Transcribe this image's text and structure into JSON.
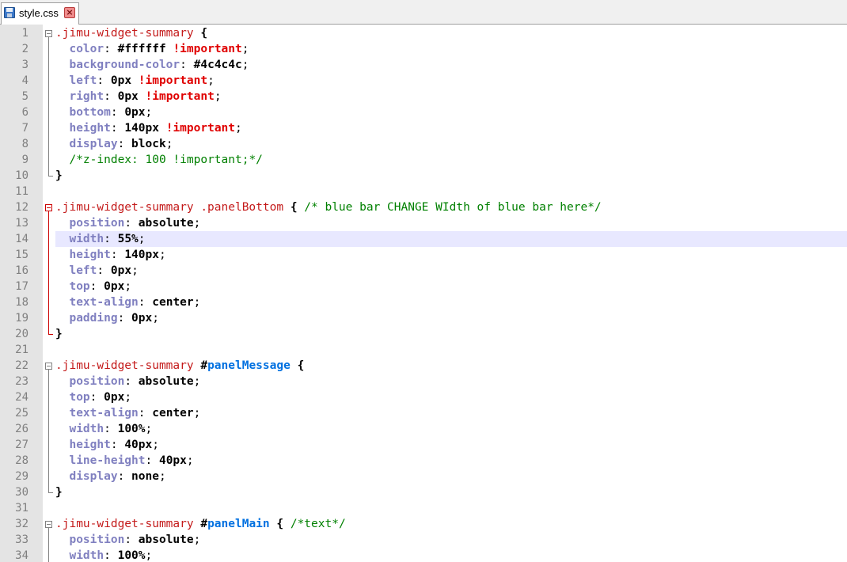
{
  "tab": {
    "filename": "style.css",
    "icon": "save-disk-icon",
    "close_icon": "close-icon"
  },
  "colors": {
    "selector": "#c41a1a",
    "property": "#8080c0",
    "important": "#e00000",
    "comment": "#008000",
    "id": "#0070e0",
    "highlight_line": "#e8e8ff",
    "gutter": "#e4e4e4"
  },
  "highlighted_line": 14,
  "lines": [
    {
      "n": "1",
      "t": [
        {
          "c": "sel",
          "s": ".jimu-widget-summary "
        },
        {
          "c": "brace",
          "s": "{"
        }
      ]
    },
    {
      "n": "2",
      "t": [
        {
          "c": "pun",
          "s": "  "
        },
        {
          "c": "prop",
          "s": "color"
        },
        {
          "c": "pun",
          "s": ": "
        },
        {
          "c": "val",
          "s": "#ffffff "
        },
        {
          "c": "imp",
          "s": "!important"
        },
        {
          "c": "pun",
          "s": ";"
        }
      ]
    },
    {
      "n": "3",
      "t": [
        {
          "c": "pun",
          "s": "  "
        },
        {
          "c": "prop",
          "s": "background-color"
        },
        {
          "c": "pun",
          "s": ": "
        },
        {
          "c": "val",
          "s": "#4c4c4c"
        },
        {
          "c": "pun",
          "s": ";"
        }
      ]
    },
    {
      "n": "4",
      "t": [
        {
          "c": "pun",
          "s": "  "
        },
        {
          "c": "prop",
          "s": "left"
        },
        {
          "c": "pun",
          "s": ": "
        },
        {
          "c": "val",
          "s": "0px "
        },
        {
          "c": "imp",
          "s": "!important"
        },
        {
          "c": "pun",
          "s": ";"
        }
      ]
    },
    {
      "n": "5",
      "t": [
        {
          "c": "pun",
          "s": "  "
        },
        {
          "c": "prop",
          "s": "right"
        },
        {
          "c": "pun",
          "s": ": "
        },
        {
          "c": "val",
          "s": "0px "
        },
        {
          "c": "imp",
          "s": "!important"
        },
        {
          "c": "pun",
          "s": ";"
        }
      ]
    },
    {
      "n": "6",
      "t": [
        {
          "c": "pun",
          "s": "  "
        },
        {
          "c": "prop",
          "s": "bottom"
        },
        {
          "c": "pun",
          "s": ": "
        },
        {
          "c": "val",
          "s": "0px"
        },
        {
          "c": "pun",
          "s": ";"
        }
      ]
    },
    {
      "n": "7",
      "t": [
        {
          "c": "pun",
          "s": "  "
        },
        {
          "c": "prop",
          "s": "height"
        },
        {
          "c": "pun",
          "s": ": "
        },
        {
          "c": "val",
          "s": "140px "
        },
        {
          "c": "imp",
          "s": "!important"
        },
        {
          "c": "pun",
          "s": ";"
        }
      ]
    },
    {
      "n": "8",
      "t": [
        {
          "c": "pun",
          "s": "  "
        },
        {
          "c": "prop",
          "s": "display"
        },
        {
          "c": "pun",
          "s": ": "
        },
        {
          "c": "val",
          "s": "block"
        },
        {
          "c": "pun",
          "s": ";"
        }
      ]
    },
    {
      "n": "9",
      "t": [
        {
          "c": "pun",
          "s": "  "
        },
        {
          "c": "cmt",
          "s": "/*z-index: 100 !important;*/"
        }
      ]
    },
    {
      "n": "10",
      "t": [
        {
          "c": "brace",
          "s": "}"
        }
      ]
    },
    {
      "n": "11",
      "t": []
    },
    {
      "n": "12",
      "t": [
        {
          "c": "sel",
          "s": ".jimu-widget-summary .panelBottom "
        },
        {
          "c": "brace",
          "s": "{"
        },
        {
          "c": "pun",
          "s": " "
        },
        {
          "c": "cmt",
          "s": "/* blue bar CHANGE WIdth of blue bar here*/"
        }
      ]
    },
    {
      "n": "13",
      "t": [
        {
          "c": "pun",
          "s": "  "
        },
        {
          "c": "prop",
          "s": "position"
        },
        {
          "c": "pun",
          "s": ": "
        },
        {
          "c": "val",
          "s": "absolute"
        },
        {
          "c": "pun",
          "s": ";"
        }
      ]
    },
    {
      "n": "14",
      "t": [
        {
          "c": "pun",
          "s": "  "
        },
        {
          "c": "prop",
          "s": "width"
        },
        {
          "c": "pun",
          "s": ": "
        },
        {
          "c": "val",
          "s": "55%"
        },
        {
          "c": "pun",
          "s": ";"
        }
      ]
    },
    {
      "n": "15",
      "t": [
        {
          "c": "pun",
          "s": "  "
        },
        {
          "c": "prop",
          "s": "height"
        },
        {
          "c": "pun",
          "s": ": "
        },
        {
          "c": "val",
          "s": "140px"
        },
        {
          "c": "pun",
          "s": ";"
        }
      ]
    },
    {
      "n": "16",
      "t": [
        {
          "c": "pun",
          "s": "  "
        },
        {
          "c": "prop",
          "s": "left"
        },
        {
          "c": "pun",
          "s": ": "
        },
        {
          "c": "val",
          "s": "0px"
        },
        {
          "c": "pun",
          "s": ";"
        }
      ]
    },
    {
      "n": "17",
      "t": [
        {
          "c": "pun",
          "s": "  "
        },
        {
          "c": "prop",
          "s": "top"
        },
        {
          "c": "pun",
          "s": ": "
        },
        {
          "c": "val",
          "s": "0px"
        },
        {
          "c": "pun",
          "s": ";"
        }
      ]
    },
    {
      "n": "18",
      "t": [
        {
          "c": "pun",
          "s": "  "
        },
        {
          "c": "prop",
          "s": "text-align"
        },
        {
          "c": "pun",
          "s": ": "
        },
        {
          "c": "val",
          "s": "center"
        },
        {
          "c": "pun",
          "s": ";"
        }
      ]
    },
    {
      "n": "19",
      "t": [
        {
          "c": "pun",
          "s": "  "
        },
        {
          "c": "prop",
          "s": "padding"
        },
        {
          "c": "pun",
          "s": ": "
        },
        {
          "c": "val",
          "s": "0px"
        },
        {
          "c": "pun",
          "s": ";"
        }
      ]
    },
    {
      "n": "20",
      "t": [
        {
          "c": "brace",
          "s": "}"
        }
      ]
    },
    {
      "n": "21",
      "t": []
    },
    {
      "n": "22",
      "t": [
        {
          "c": "sel",
          "s": ".jimu-widget-summary "
        },
        {
          "c": "val",
          "s": "#"
        },
        {
          "c": "id",
          "s": "panelMessage"
        },
        {
          "c": "pun",
          "s": " "
        },
        {
          "c": "brace",
          "s": "{"
        }
      ]
    },
    {
      "n": "23",
      "t": [
        {
          "c": "pun",
          "s": "  "
        },
        {
          "c": "prop",
          "s": "position"
        },
        {
          "c": "pun",
          "s": ": "
        },
        {
          "c": "val",
          "s": "absolute"
        },
        {
          "c": "pun",
          "s": ";"
        }
      ]
    },
    {
      "n": "24",
      "t": [
        {
          "c": "pun",
          "s": "  "
        },
        {
          "c": "prop",
          "s": "top"
        },
        {
          "c": "pun",
          "s": ": "
        },
        {
          "c": "val",
          "s": "0px"
        },
        {
          "c": "pun",
          "s": ";"
        }
      ]
    },
    {
      "n": "25",
      "t": [
        {
          "c": "pun",
          "s": "  "
        },
        {
          "c": "prop",
          "s": "text-align"
        },
        {
          "c": "pun",
          "s": ": "
        },
        {
          "c": "val",
          "s": "center"
        },
        {
          "c": "pun",
          "s": ";"
        }
      ]
    },
    {
      "n": "26",
      "t": [
        {
          "c": "pun",
          "s": "  "
        },
        {
          "c": "prop",
          "s": "width"
        },
        {
          "c": "pun",
          "s": ": "
        },
        {
          "c": "val",
          "s": "100%"
        },
        {
          "c": "pun",
          "s": ";"
        }
      ]
    },
    {
      "n": "27",
      "t": [
        {
          "c": "pun",
          "s": "  "
        },
        {
          "c": "prop",
          "s": "height"
        },
        {
          "c": "pun",
          "s": ": "
        },
        {
          "c": "val",
          "s": "40px"
        },
        {
          "c": "pun",
          "s": ";"
        }
      ]
    },
    {
      "n": "28",
      "t": [
        {
          "c": "pun",
          "s": "  "
        },
        {
          "c": "prop",
          "s": "line-height"
        },
        {
          "c": "pun",
          "s": ": "
        },
        {
          "c": "val",
          "s": "40px"
        },
        {
          "c": "pun",
          "s": ";"
        }
      ]
    },
    {
      "n": "29",
      "t": [
        {
          "c": "pun",
          "s": "  "
        },
        {
          "c": "prop",
          "s": "display"
        },
        {
          "c": "pun",
          "s": ": "
        },
        {
          "c": "val",
          "s": "none"
        },
        {
          "c": "pun",
          "s": ";"
        }
      ]
    },
    {
      "n": "30",
      "t": [
        {
          "c": "brace",
          "s": "}"
        }
      ]
    },
    {
      "n": "31",
      "t": []
    },
    {
      "n": "32",
      "t": [
        {
          "c": "sel",
          "s": ".jimu-widget-summary "
        },
        {
          "c": "val",
          "s": "#"
        },
        {
          "c": "id",
          "s": "panelMain"
        },
        {
          "c": "pun",
          "s": " "
        },
        {
          "c": "brace",
          "s": "{"
        },
        {
          "c": "pun",
          "s": " "
        },
        {
          "c": "cmt",
          "s": "/*text*/"
        }
      ]
    },
    {
      "n": "33",
      "t": [
        {
          "c": "pun",
          "s": "  "
        },
        {
          "c": "prop",
          "s": "position"
        },
        {
          "c": "pun",
          "s": ": "
        },
        {
          "c": "val",
          "s": "absolute"
        },
        {
          "c": "pun",
          "s": ";"
        }
      ]
    },
    {
      "n": "34",
      "t": [
        {
          "c": "pun",
          "s": "  "
        },
        {
          "c": "prop",
          "s": "width"
        },
        {
          "c": "pun",
          "s": ": "
        },
        {
          "c": "val",
          "s": "100%"
        },
        {
          "c": "pun",
          "s": ";"
        }
      ]
    }
  ]
}
